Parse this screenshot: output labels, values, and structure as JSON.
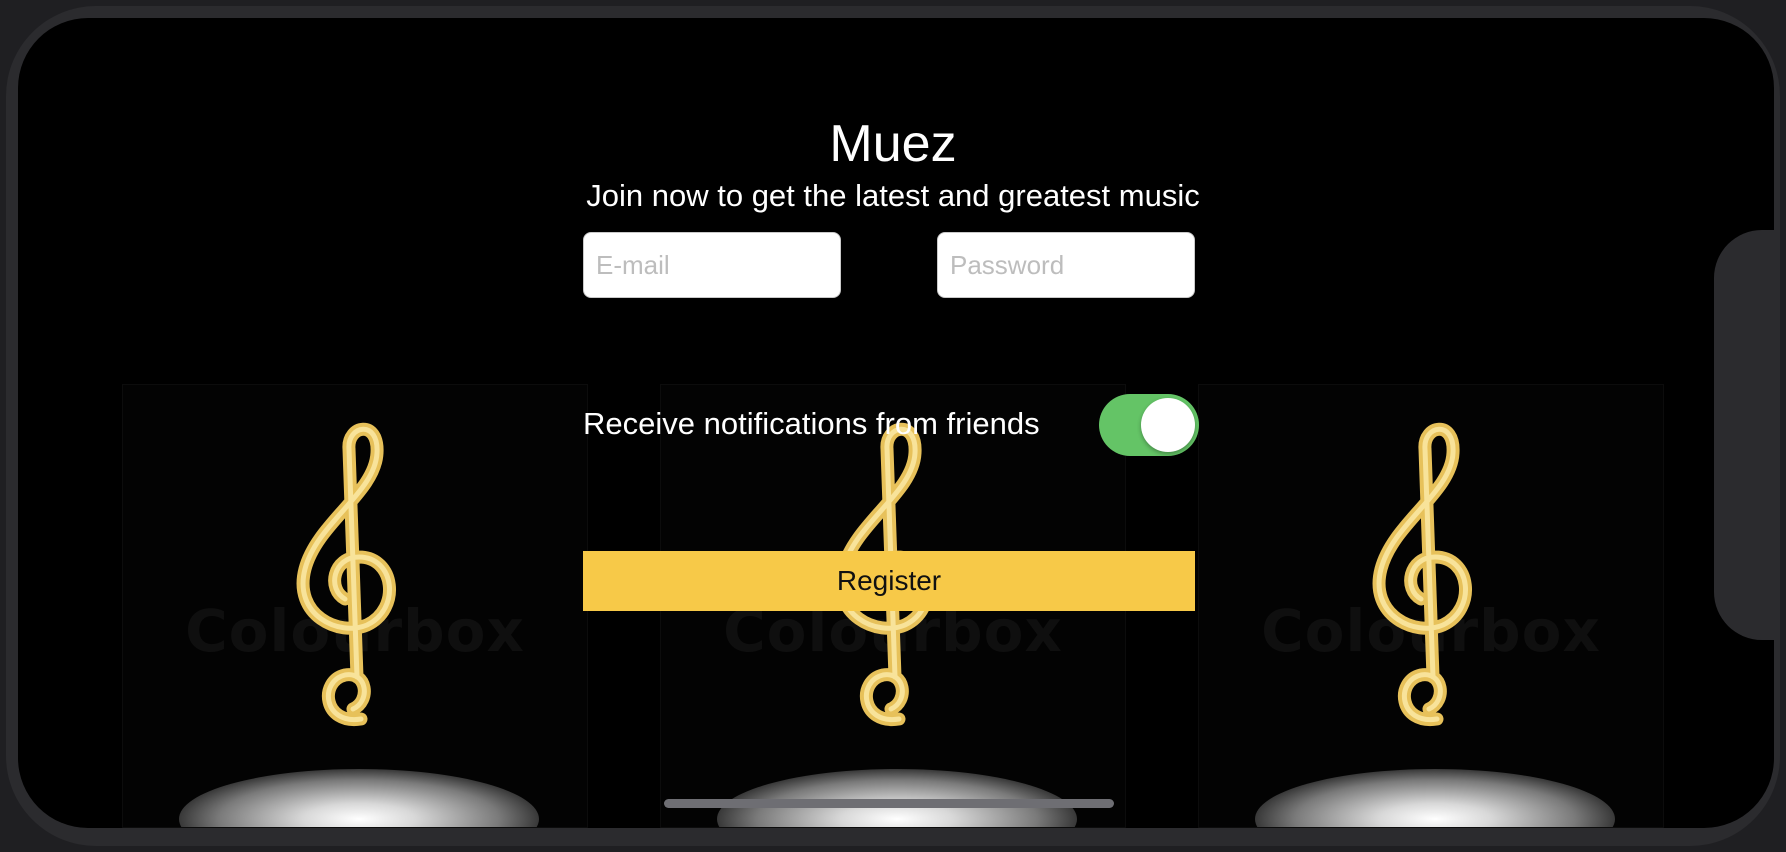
{
  "app": {
    "title": "Muez",
    "subtitle": "Join now to get the latest and greatest music"
  },
  "form": {
    "email_placeholder": "E-mail",
    "password_placeholder": "Password",
    "notifications_label": "Receive notifications from friends",
    "notifications_enabled": true,
    "register_label": "Register"
  },
  "background": {
    "watermark_text": "Colourbox",
    "image_icon": "treble-clef-icon"
  },
  "colors": {
    "accent_button": "#f7c948",
    "toggle_on": "#64c466",
    "clef_gold": "#e7c15a"
  }
}
